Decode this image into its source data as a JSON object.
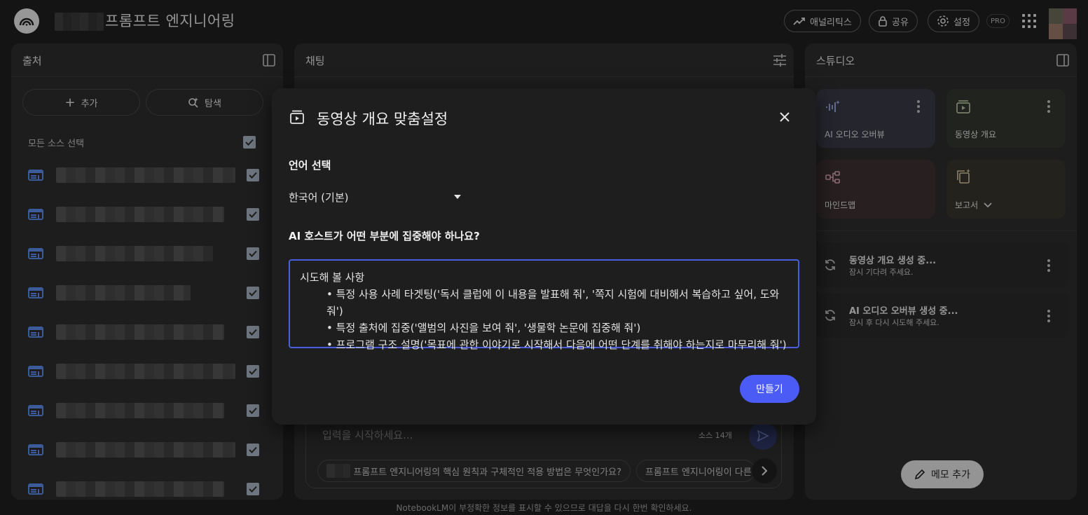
{
  "header": {
    "title": "프롬프트 엔지니어링",
    "analytics_label": "애널리틱스",
    "share_label": "공유",
    "settings_label": "설정",
    "pro_badge": "PRO"
  },
  "sources": {
    "title": "출처",
    "add_label": "추가",
    "explore_label": "탐색",
    "select_all_label": "모든 소스 선택",
    "items_count_visible": 9
  },
  "chat": {
    "title": "채팅",
    "input_placeholder": "입력을 시작하세요...",
    "source_count": "소스 14개",
    "suggestion_1": "프롬프트 엔지니어링의 핵심 원칙과 구체적인 적용 방법은 무엇인가요?",
    "suggestion_2": "프롬프트 엔지니어링이 다른"
  },
  "studio": {
    "title": "스튜디오",
    "cards": {
      "audio": "AI 오디오 오버뷰",
      "video": "동영상 개요",
      "mindmap": "마인드맵",
      "report": "보고서"
    },
    "jobs": [
      {
        "title": "동영상 개요 생성 중...",
        "subtitle": "잠시 기다려 주세요."
      },
      {
        "title": "AI 오디오 오버뷰 생성 중...",
        "subtitle": "잠시 후 다시 시도해 주세요."
      }
    ],
    "memo_label": "메모 추가"
  },
  "modal": {
    "title": "동영상 개요 맞춤설정",
    "language_label": "언어 선택",
    "language_value": "한국어 (기본)",
    "focus_label": "AI 호스트가 어떤 부분에 집중해야 하나요?",
    "textarea_heading": "시도해 볼 사항",
    "textarea_bullet_1": "• 특정 사용 사례 타겟팅('독서 클럽에 이 내용을 발표해 줘', '쪽지 시험에 대비해서 복습하고 싶어, 도와줘')",
    "textarea_bullet_2": "• 특정 출처에 집중('앨범의 사진을 보여 줘', '생물학 논문에 집중해 줘')",
    "textarea_bullet_3": "• 프로그램 구조 설명('목표에 관한 이야기로 시작해서 다음에 어떤 단계를 취해야 하는지로 마무리해 줘')",
    "create_label": "만들기"
  },
  "footer": {
    "disclaimer": "NotebookLM이 부정확한 정보를 표시할 수 있으므로 대답을 다시 한번 확인하세요."
  },
  "colors": {
    "accent": "#4a5cf5",
    "background": "#1f1f1f",
    "panel": "#2d2d2d",
    "source_icon": "#5b8def"
  }
}
